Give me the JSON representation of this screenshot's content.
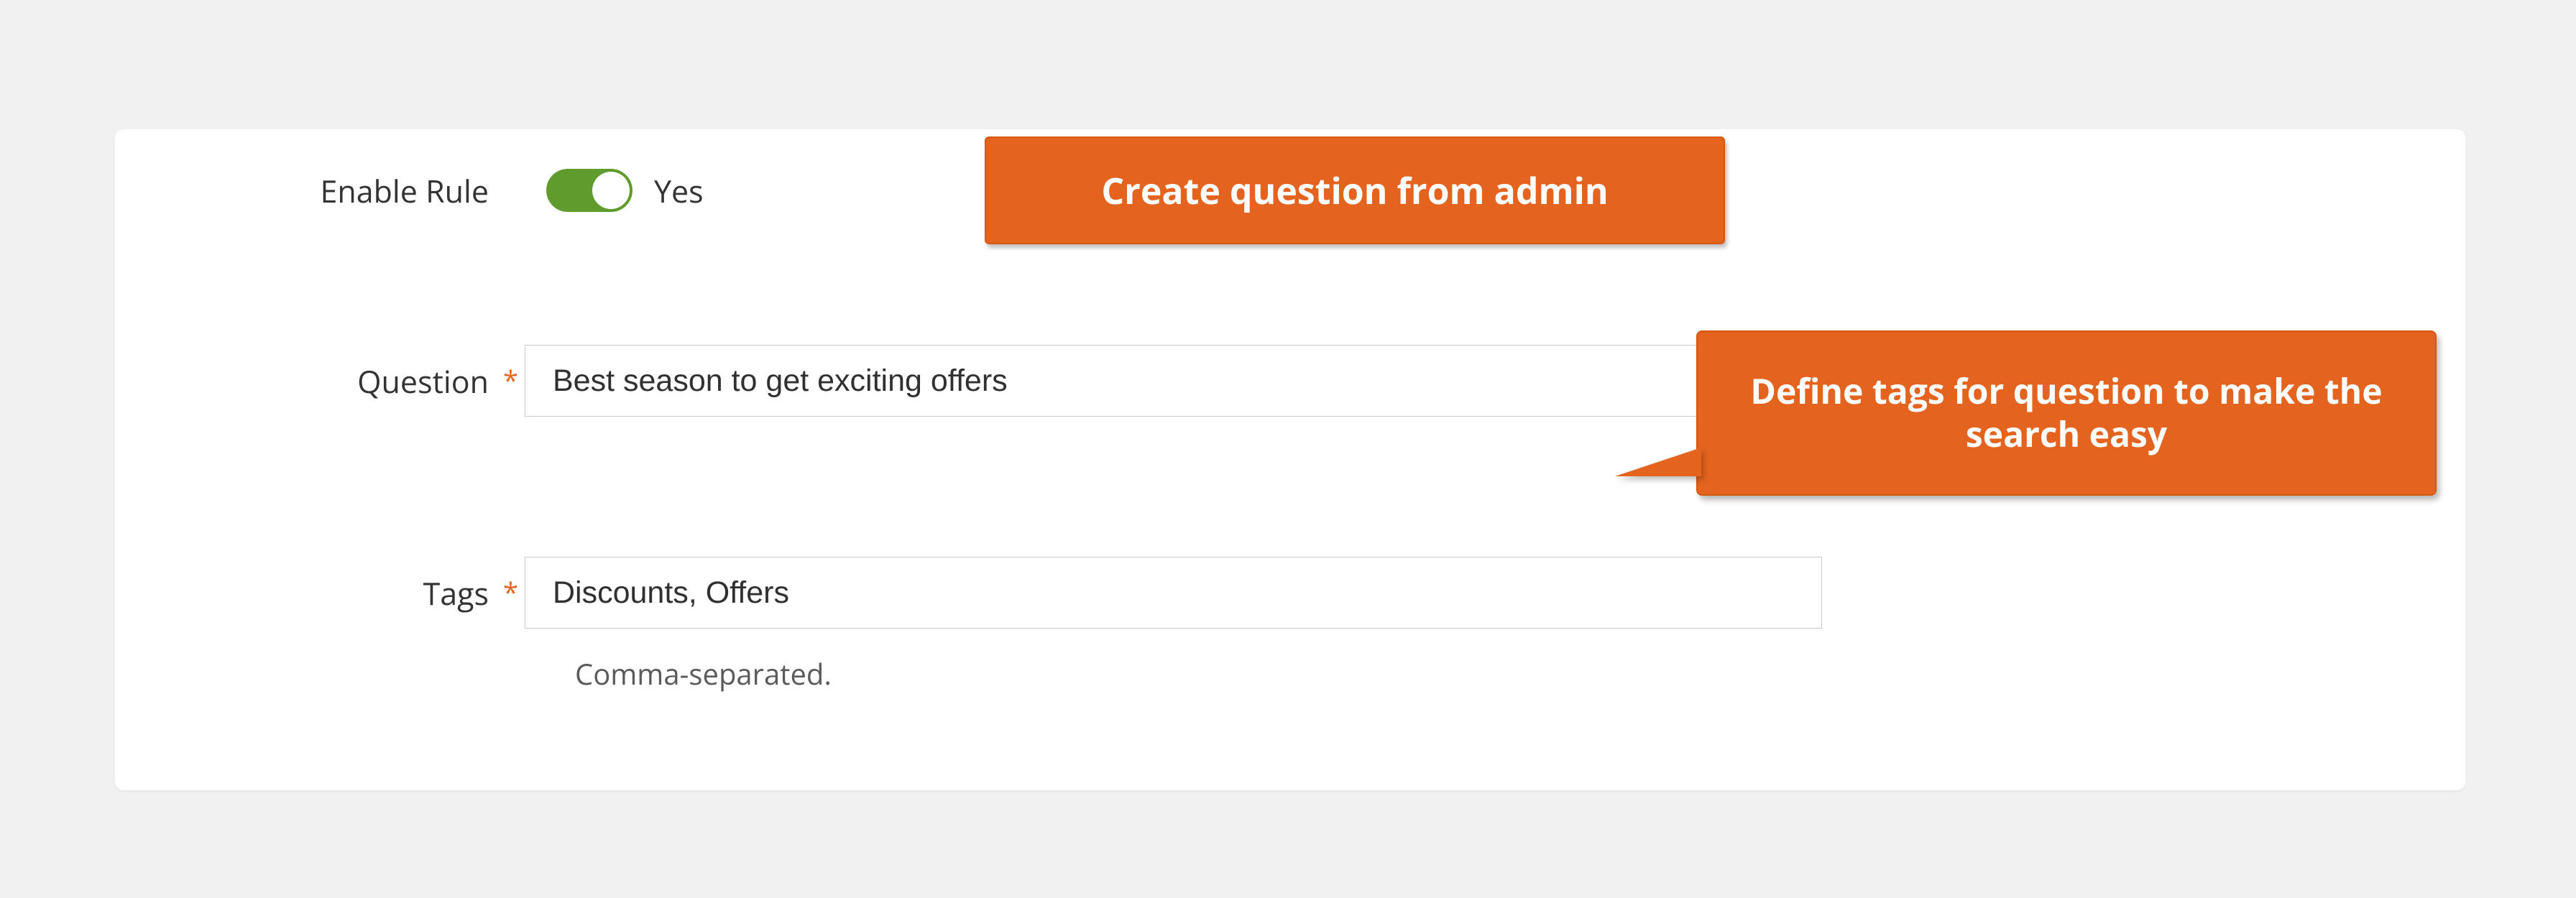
{
  "form": {
    "enable_rule": {
      "label": "Enable Rule",
      "value_text": "Yes",
      "on": true
    },
    "question": {
      "label": "Question",
      "value": "Best season to get exciting offers"
    },
    "tags": {
      "label": "Tags",
      "value": "Discounts, Offers",
      "helper": "Comma-separated."
    }
  },
  "callouts": {
    "create_question": "Create question from admin",
    "define_tags": "Define tags for question to make the search easy"
  },
  "colors": {
    "accent": "#e4641f",
    "toggle_on": "#5f9b2d"
  }
}
